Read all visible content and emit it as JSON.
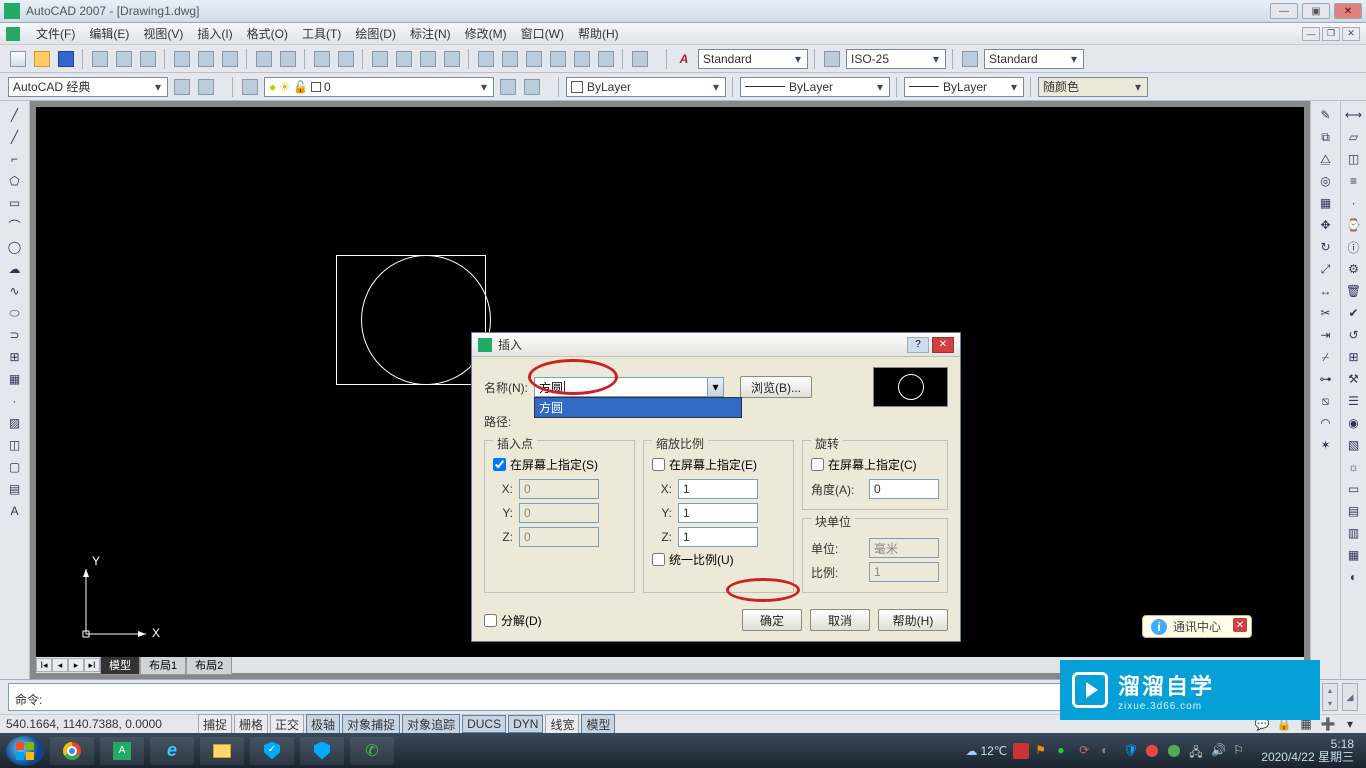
{
  "app": {
    "title": "AutoCAD 2007 - [Drawing1.dwg]"
  },
  "menu": {
    "items": [
      "文件(F)",
      "编辑(E)",
      "视图(V)",
      "插入(I)",
      "格式(O)",
      "工具(T)",
      "绘图(D)",
      "标注(N)",
      "修改(M)",
      "窗口(W)",
      "帮助(H)"
    ]
  },
  "toolbar1": {
    "text_style": "Standard",
    "dim_style": "ISO-25",
    "table_style": "Standard"
  },
  "toolbar2": {
    "workspace": "AutoCAD 经典",
    "layer": "0",
    "linetype": "ByLayer",
    "lineweight": "ByLayer",
    "plotstyle": "ByLayer",
    "color": "随颜色"
  },
  "tabs": {
    "model": "模型",
    "layout1": "布局1",
    "layout2": "布局2"
  },
  "ucs": {
    "x": "X",
    "y": "Y"
  },
  "dialog": {
    "title": "插入",
    "name_label": "名称(N):",
    "name_value": "方圆",
    "name_option": "方圆",
    "browse": "浏览(B)...",
    "path_label": "路径:",
    "group_insert": "插入点",
    "group_scale": "缩放比例",
    "group_rotate": "旋转",
    "onscreen_s": "在屏幕上指定(S)",
    "onscreen_e": "在屏幕上指定(E)",
    "onscreen_c": "在屏幕上指定(C)",
    "x": "X:",
    "y": "Y:",
    "z": "Z:",
    "ix": "0",
    "iy": "0",
    "iz": "0",
    "sx": "1",
    "sy": "1",
    "sz": "1",
    "uniform": "统一比例(U)",
    "angle_label": "角度(A):",
    "angle": "0",
    "blockunit": "块单位",
    "unit_label": "单位:",
    "unit": "毫米",
    "ratio_label": "比例:",
    "ratio": "1",
    "explode": "分解(D)",
    "ok": "确定",
    "cancel": "取消",
    "help": "帮助(H)"
  },
  "cmd": {
    "prompt": "命令:"
  },
  "status": {
    "coords": "540.1664, 1140.7388, 0.0000",
    "buttons": [
      "捕捉",
      "栅格",
      "正交",
      "极轴",
      "对象捕捉",
      "对象追踪",
      "DUCS",
      "DYN",
      "线宽",
      "模型"
    ]
  },
  "tray": {
    "weather": "12℃",
    "time": "5:18",
    "date": "2020/4/22 星期三"
  },
  "watermark": {
    "cn": "溜溜自学",
    "en": "zixue.3d66.com"
  },
  "infocenter": {
    "label": "通讯中心"
  }
}
